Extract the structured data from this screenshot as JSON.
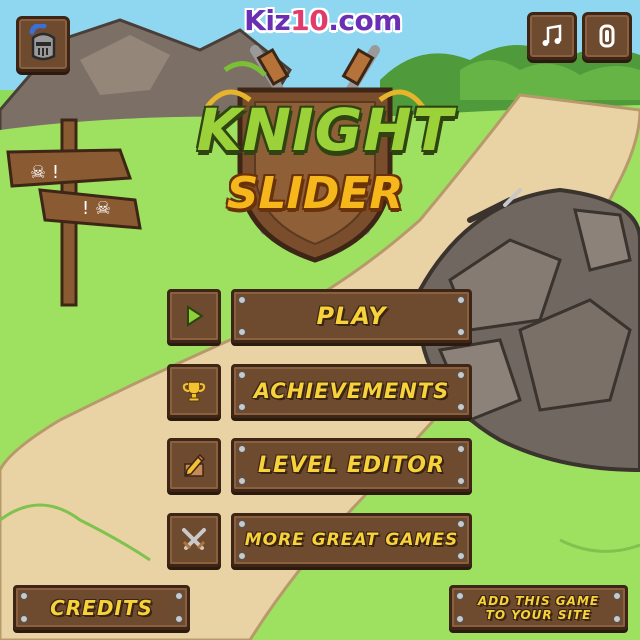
{
  "brand": {
    "name_part1": "Kiz",
    "name_part2": "10",
    "name_part3": ".com"
  },
  "title": {
    "line1": "KNIGHT",
    "line2": "SLIDER"
  },
  "menu": {
    "play": "PLAY",
    "achievements": "ACHIEVEMENTS",
    "level_editor": "LEVEL EDITOR",
    "more_games": "MORE GREAT GAMES"
  },
  "footer": {
    "credits": "CREDITS",
    "add_game_line1": "ADD THIS GAME",
    "add_game_line2": "TO YOUR SITE"
  },
  "icons": {
    "profile": "knight-helmet-icon",
    "music": "music-note-icon",
    "sound": "sound-icon",
    "play": "play-triangle-icon",
    "achievements": "trophy-icon",
    "level_editor": "pencil-icon",
    "more_games": "crossed-swords-icon"
  },
  "colors": {
    "button_wood": "#6e4a2e",
    "button_text": "#f7d23a",
    "title_green": "#9bd23a",
    "title_orange": "#f6b71d",
    "brand_purple": "#6a2fb3"
  }
}
